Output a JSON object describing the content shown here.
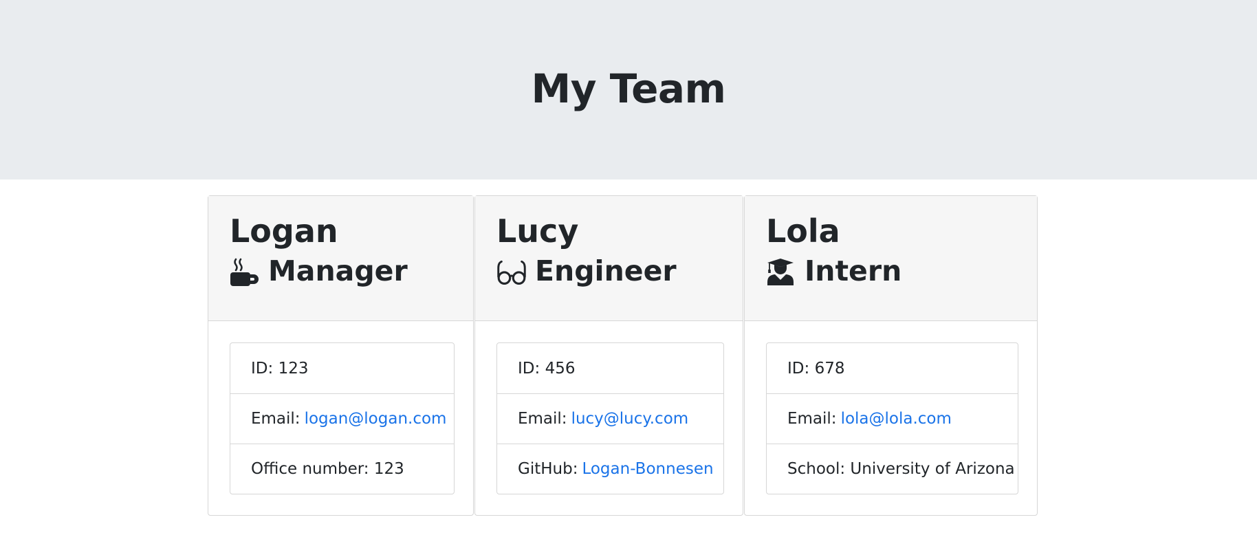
{
  "header": {
    "title": "My Team"
  },
  "cards": [
    {
      "name": "Logan",
      "role": "Manager",
      "role_icon": "coffee-mug-icon",
      "id_label": "ID:",
      "id": "123",
      "email_label": "Email:",
      "email": "logan@logan.com",
      "extra_label": "Office number:",
      "extra": "123"
    },
    {
      "name": "Lucy",
      "role": "Engineer",
      "role_icon": "glasses-icon",
      "id_label": "ID:",
      "id": "456",
      "email_label": "Email:",
      "email": "lucy@lucy.com",
      "extra_label": "GitHub:",
      "extra": "Logan-Bonnesen"
    },
    {
      "name": "Lola",
      "role": "Intern",
      "role_icon": "graduate-icon",
      "id_label": "ID:",
      "id": "678",
      "email_label": "Email:",
      "email": "lola@lola.com",
      "extra_label": "School:",
      "extra": "University of Arizona"
    }
  ],
  "colors": {
    "jumbotron": "#e9ecef",
    "link": "#1a73e8",
    "card_header": "#f6f6f6",
    "text": "#212529"
  }
}
